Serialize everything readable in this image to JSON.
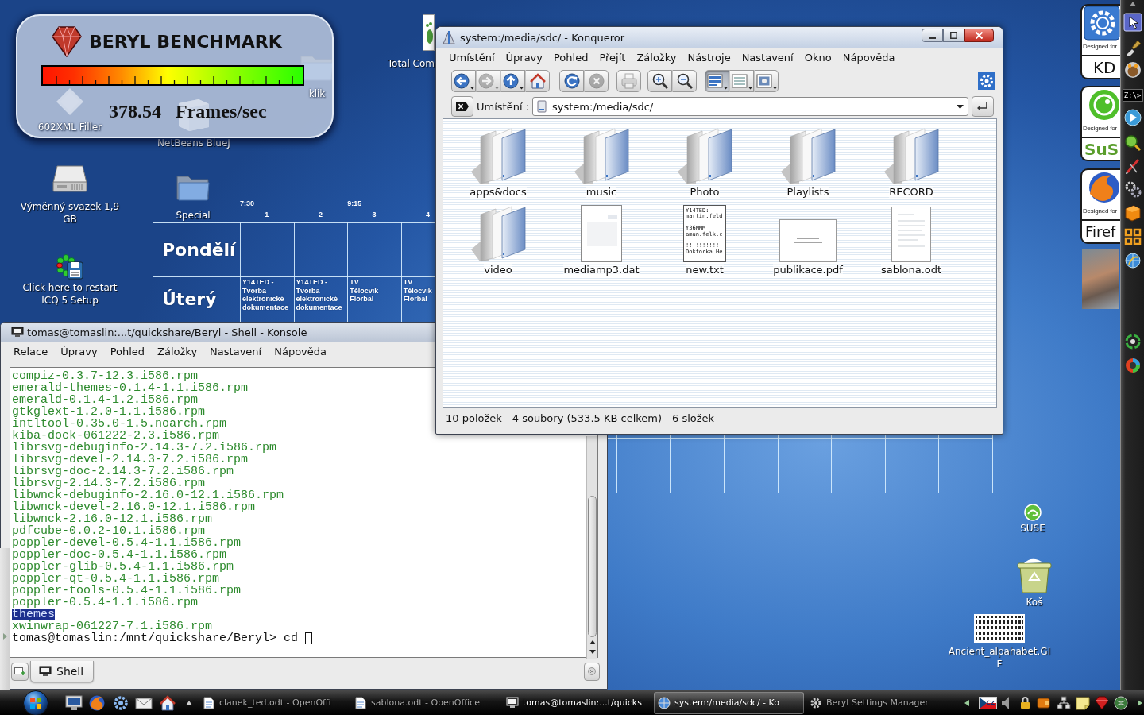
{
  "benchmark": {
    "title": "BERYL BENCHMARK",
    "fps": "378.54",
    "unit": "Frames/sec"
  },
  "desktop_icons": [
    {
      "label": "klik",
      "kind": "folder"
    },
    {
      "label": "602XML Filler",
      "kind": "diamond"
    },
    {
      "label": "NetBeans BlueJ",
      "kind": "cube"
    },
    {
      "label": "Total Com",
      "kind": "footprint"
    },
    {
      "label": "Výměnný svazek 1,9 GB",
      "kind": "drive"
    },
    {
      "label": "Special",
      "kind": "folder"
    },
    {
      "label": "Click here to restart ICQ 5 Setup",
      "kind": "flower"
    },
    {
      "label": "SUSE",
      "kind": "chameleon"
    },
    {
      "label": "Koš",
      "kind": "trash"
    },
    {
      "label": "Ancient_alpahabet.GIF",
      "kind": "image"
    }
  ],
  "timetable": {
    "columns": [
      {
        "number": "1",
        "time": "7:30"
      },
      {
        "number": "2"
      },
      {
        "number": "3",
        "time": "9:15"
      },
      {
        "number": "4"
      }
    ],
    "days": [
      {
        "name": "Pondělí"
      },
      {
        "name": "Úterý",
        "cells": [
          "Y14TED -\nTvorba\nelektronické\ndokumentace",
          "Y14TED -\nTvorba\nelektronické\ndokumentace",
          "TV\nTělocvik\nFlorbal",
          "TV\nTělocvik\nFlorbal"
        ]
      }
    ]
  },
  "badges": [
    {
      "caption": "Designed for",
      "name": "KD",
      "kind": "kde"
    },
    {
      "caption": "Designed for",
      "name": "SuS",
      "kind": "suse"
    },
    {
      "caption": "Designed for",
      "name": "Firef",
      "kind": "firefox"
    }
  ],
  "side_panel": {
    "terminal_label": "Z:\\>"
  },
  "konsole": {
    "title": "tomas@tomaslin:...t/quickshare/Beryl - Shell - Konsole",
    "menu": [
      "Relace",
      "Úpravy",
      "Pohled",
      "Záložky",
      "Nastavení",
      "Nápověda"
    ],
    "lines": [
      {
        "text": "compiz-0.3.7-12.3.i586.rpm",
        "kind": "file"
      },
      {
        "text": "emerald-themes-0.1.4-1.1.i586.rpm",
        "kind": "file"
      },
      {
        "text": "emerald-0.1.4-1.2.i586.rpm",
        "kind": "file"
      },
      {
        "text": "gtkglext-1.2.0-1.1.i586.rpm",
        "kind": "file"
      },
      {
        "text": "intltool-0.35.0-1.5.noarch.rpm",
        "kind": "file"
      },
      {
        "text": "kiba-dock-061222-2.3.i586.rpm",
        "kind": "file"
      },
      {
        "text": "librsvg-debuginfo-2.14.3-7.2.i586.rpm",
        "kind": "file"
      },
      {
        "text": "librsvg-devel-2.14.3-7.2.i586.rpm",
        "kind": "file"
      },
      {
        "text": "librsvg-doc-2.14.3-7.2.i586.rpm",
        "kind": "file"
      },
      {
        "text": "librsvg-2.14.3-7.2.i586.rpm",
        "kind": "file"
      },
      {
        "text": "libwnck-debuginfo-2.16.0-12.1.i586.rpm",
        "kind": "file"
      },
      {
        "text": "libwnck-devel-2.16.0-12.1.i586.rpm",
        "kind": "file"
      },
      {
        "text": "libwnck-2.16.0-12.1.i586.rpm",
        "kind": "file"
      },
      {
        "text": "pdfcube-0.0.2-10.1.i586.rpm",
        "kind": "file"
      },
      {
        "text": "poppler-devel-0.5.4-1.1.i586.rpm",
        "kind": "file"
      },
      {
        "text": "poppler-doc-0.5.4-1.1.i586.rpm",
        "kind": "file"
      },
      {
        "text": "poppler-glib-0.5.4-1.1.i586.rpm",
        "kind": "file"
      },
      {
        "text": "poppler-qt-0.5.4-1.1.i586.rpm",
        "kind": "file"
      },
      {
        "text": "poppler-tools-0.5.4-1.1.i586.rpm",
        "kind": "file"
      },
      {
        "text": "poppler-0.5.4-1.1.i586.rpm",
        "kind": "file"
      },
      {
        "text": "themes",
        "kind": "directory"
      },
      {
        "text": "xwinwrap-061227-7.1.i586.rpm",
        "kind": "file"
      },
      {
        "text": "tomas@tomaslin:/mnt/quickshare/Beryl> cd",
        "kind": "prompt"
      }
    ],
    "tabs": [
      {
        "label": "Shell",
        "selected": true
      }
    ]
  },
  "konqueror": {
    "title": "system:/media/sdc/ - Konqueror",
    "menu": [
      "Umístění",
      "Úpravy",
      "Pohled",
      "Přejít",
      "Záložky",
      "Nástroje",
      "Nastavení",
      "Okno",
      "Nápověda"
    ],
    "toolbar": [
      [
        {
          "kind": "back",
          "disabled": false,
          "pressed": false
        },
        {
          "kind": "forward",
          "disabled": true,
          "pressed": false
        },
        {
          "kind": "up",
          "disabled": false,
          "pressed": false
        },
        {
          "kind": "home",
          "disabled": false,
          "pressed": false
        }
      ],
      [
        {
          "kind": "reload",
          "disabled": false,
          "pressed": false
        },
        {
          "kind": "stop",
          "disabled": true,
          "pressed": false
        }
      ],
      [
        {
          "kind": "print",
          "disabled": true,
          "pressed": false
        }
      ],
      [
        {
          "kind": "zoom_in",
          "disabled": false,
          "pressed": false
        },
        {
          "kind": "zoom_out",
          "disabled": false,
          "pressed": false
        }
      ],
      [
        {
          "kind": "icon_view",
          "disabled": false,
          "pressed": true
        },
        {
          "kind": "detail_view",
          "disabled": false,
          "pressed": false
        },
        {
          "kind": "preview",
          "disabled": false,
          "pressed": false
        }
      ]
    ],
    "location": {
      "label": "Umístění :",
      "value": "system:/media/sdc/"
    },
    "files": [
      {
        "name": "apps&docs",
        "kind": "folder"
      },
      {
        "name": "music",
        "kind": "folder"
      },
      {
        "name": "Photo",
        "kind": "folder"
      },
      {
        "name": "Playlists",
        "kind": "folder"
      },
      {
        "name": "RECORD",
        "kind": "folder"
      },
      {
        "name": "video",
        "kind": "folder"
      },
      {
        "name": "mediamp3.dat",
        "kind": "document"
      },
      {
        "name": "new.txt",
        "kind": "text",
        "preview": "Y14TED:\nmartin.feld\n\nY36MMM\namun.felk.c\n\n!!!!!!!!!!\nDoktorka He"
      },
      {
        "name": "publikace.pdf",
        "kind": "pdf"
      },
      {
        "name": "sablona.odt",
        "kind": "page"
      }
    ],
    "status": "10 položek - 4 soubory (533.5 KB celkem) - 6 složek"
  },
  "taskbar": {
    "tasks": [
      {
        "label": "clanek_ted.odt - OpenOffi",
        "kind": "document",
        "minimized": true,
        "selected": false
      },
      {
        "label": "sablona.odt - OpenOffice",
        "kind": "document",
        "minimized": true,
        "selected": false
      },
      {
        "label": "tomas@tomaslin:...t/quicks",
        "kind": "terminal",
        "minimized": false,
        "selected": false
      },
      {
        "label": "system:/media/sdc/ - Ko",
        "kind": "browser",
        "minimized": false,
        "selected": true
      },
      {
        "label": "Beryl Settings Manager",
        "kind": "settings",
        "minimized": true,
        "selected": false
      }
    ],
    "keyboard_layout": "CZ"
  }
}
